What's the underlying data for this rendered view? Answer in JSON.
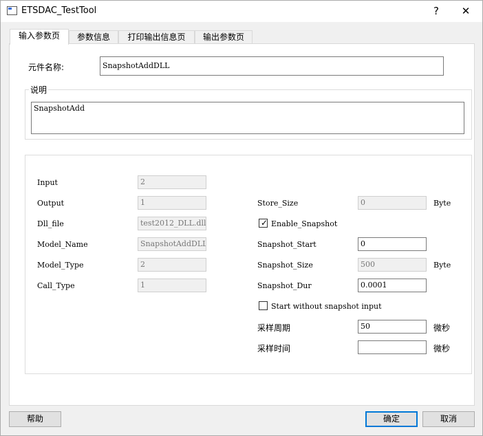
{
  "window": {
    "title": "ETSDAC_TestTool",
    "help_glyph": "?",
    "close_glyph": "✕"
  },
  "tabs": [
    "输入参数页",
    "参数信息",
    "打印输出信息页",
    "输出参数页"
  ],
  "top": {
    "component_name_label": "元件名称:",
    "component_name_value": "SnapshotAddDLL",
    "description_label": "说明",
    "description_value": "SnapshotAdd"
  },
  "left_params": [
    {
      "label": "Input",
      "value": "2"
    },
    {
      "label": "Output",
      "value": "1"
    },
    {
      "label": "Dll_file",
      "value": "test2012_DLL.dll"
    },
    {
      "label": "Model_Name",
      "value": "SnapshotAddDLL"
    },
    {
      "label": "Model_Type",
      "value": "2"
    },
    {
      "label": "Call_Type",
      "value": "1"
    }
  ],
  "right_params": {
    "store_size": {
      "label": "Store_Size",
      "value": "0",
      "unit": "Byte"
    },
    "enable_snapshot": {
      "label": "Enable_Snapshot",
      "checked": true,
      "mark": "✓"
    },
    "snapshot_start": {
      "label": "Snapshot_Start",
      "value": "0"
    },
    "snapshot_size": {
      "label": "Snapshot_Size",
      "value": "500",
      "unit": "Byte"
    },
    "snapshot_dur": {
      "label": "Snapshot_Dur",
      "value": "0.0001"
    },
    "start_without": {
      "label": "Start without snapshot input",
      "checked": false
    },
    "sample_period": {
      "label": "采样周期",
      "value": "50",
      "unit": "微秒"
    },
    "sample_time": {
      "label": "采样时间",
      "value": "",
      "unit": "微秒"
    }
  },
  "buttons": {
    "help": "帮助",
    "ok": "确定",
    "cancel": "取消"
  }
}
